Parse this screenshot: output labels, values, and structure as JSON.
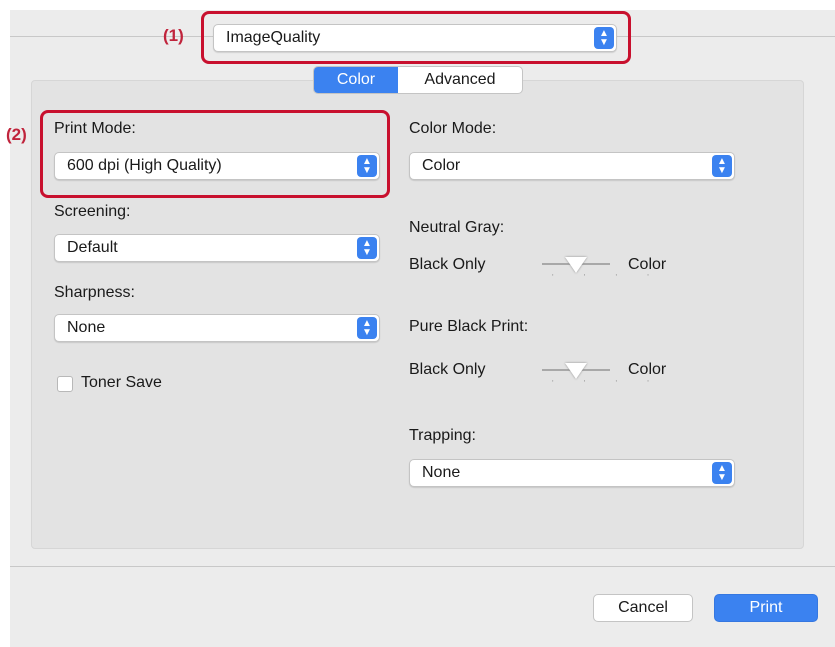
{
  "preset_menu": {
    "value": "ImageQuality",
    "callout": "(1)"
  },
  "tabs": [
    {
      "label": "Color",
      "active": true
    },
    {
      "label": "Advanced",
      "active": false
    }
  ],
  "left": {
    "print_mode": {
      "label": "Print Mode:",
      "value": "600 dpi (High Quality)",
      "callout": "(2)"
    },
    "screening": {
      "label": "Screening:",
      "value": "Default"
    },
    "sharpness": {
      "label": "Sharpness:",
      "value": "None"
    },
    "toner_save": {
      "label": "Toner Save",
      "checked": false
    }
  },
  "right": {
    "color_mode": {
      "label": "Color Mode:",
      "value": "Color"
    },
    "neutral_gray": {
      "label": "Neutral Gray:",
      "min_label": "Black Only",
      "max_label": "Color",
      "level": 0.5
    },
    "pure_black_print": {
      "label": "Pure Black Print:",
      "min_label": "Black Only",
      "max_label": "Color",
      "level": 0.5
    },
    "trapping": {
      "label": "Trapping:",
      "value": "None"
    }
  },
  "buttons": {
    "cancel": "Cancel",
    "print": "Print"
  },
  "colors": {
    "accent": "#3b82f0",
    "callout": "#c8102e"
  }
}
